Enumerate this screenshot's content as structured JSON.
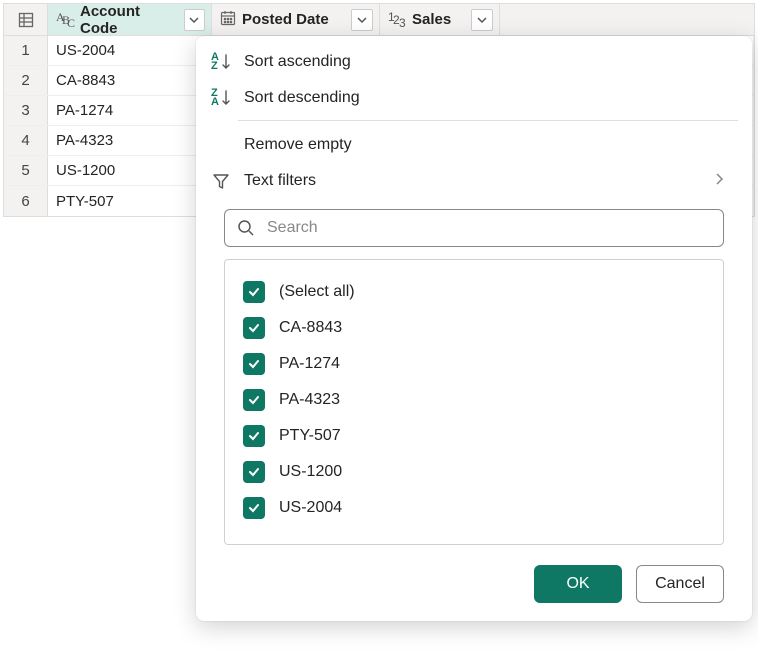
{
  "columns": [
    {
      "name": "Account Code",
      "type": "text"
    },
    {
      "name": "Posted Date",
      "type": "date"
    },
    {
      "name": "Sales",
      "type": "number"
    }
  ],
  "rows": [
    {
      "n": "1",
      "v": "US-2004"
    },
    {
      "n": "2",
      "v": "CA-8843"
    },
    {
      "n": "3",
      "v": "PA-1274"
    },
    {
      "n": "4",
      "v": "PA-4323"
    },
    {
      "n": "5",
      "v": "US-1200"
    },
    {
      "n": "6",
      "v": "PTY-507"
    }
  ],
  "menu": {
    "sort_asc": "Sort ascending",
    "sort_desc": "Sort descending",
    "remove_empty": "Remove empty",
    "text_filters": "Text filters"
  },
  "search": {
    "placeholder": "Search"
  },
  "filter_values": [
    {
      "label": "(Select all)"
    },
    {
      "label": "CA-8843"
    },
    {
      "label": "PA-1274"
    },
    {
      "label": "PA-4323"
    },
    {
      "label": "PTY-507"
    },
    {
      "label": "US-1200"
    },
    {
      "label": "US-2004"
    }
  ],
  "buttons": {
    "ok": "OK",
    "cancel": "Cancel"
  }
}
